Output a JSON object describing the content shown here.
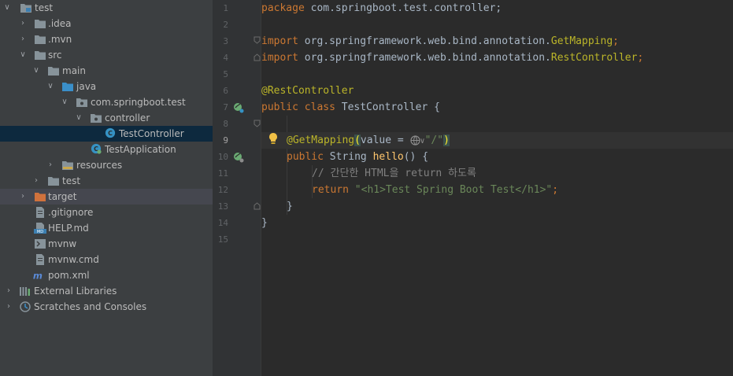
{
  "project_tree": {
    "items": [
      {
        "label": "test",
        "expanded": true,
        "icon": "module-folder-icon"
      },
      {
        "label": ".idea",
        "expanded": false,
        "icon": "folder-icon"
      },
      {
        "label": ".mvn",
        "expanded": false,
        "icon": "folder-icon"
      },
      {
        "label": "src",
        "expanded": true,
        "icon": "folder-icon"
      },
      {
        "label": "main",
        "expanded": true,
        "icon": "folder-icon"
      },
      {
        "label": "java",
        "expanded": true,
        "icon": "source-folder-icon"
      },
      {
        "label": "com.springboot.test",
        "expanded": true,
        "icon": "package-icon"
      },
      {
        "label": "controller",
        "expanded": true,
        "icon": "package-icon"
      },
      {
        "label": "TestController",
        "icon": "class-icon"
      },
      {
        "label": "TestApplication",
        "icon": "spring-boot-class-icon"
      },
      {
        "label": "resources",
        "expanded": false,
        "icon": "resources-folder-icon"
      },
      {
        "label": "test",
        "expanded": false,
        "icon": "folder-icon"
      },
      {
        "label": "target",
        "expanded": false,
        "icon": "excluded-folder-icon"
      },
      {
        "label": ".gitignore",
        "icon": "text-file-icon"
      },
      {
        "label": "HELP.md",
        "icon": "markdown-file-icon"
      },
      {
        "label": "mvnw",
        "icon": "shell-file-icon"
      },
      {
        "label": "mvnw.cmd",
        "icon": "text-file-icon"
      },
      {
        "label": "pom.xml",
        "icon": "maven-file-icon"
      },
      {
        "label": "External Libraries",
        "expanded": false,
        "icon": "libraries-icon"
      },
      {
        "label": "Scratches and Consoles",
        "expanded": false,
        "icon": "scratches-icon"
      }
    ]
  },
  "editor": {
    "line_numbers": [
      "1",
      "2",
      "3",
      "4",
      "5",
      "6",
      "7",
      "8",
      "9",
      "10",
      "11",
      "12",
      "13",
      "14",
      "15"
    ],
    "current_line": "9",
    "code": {
      "l1_kw": "package",
      "l1_rest": " com.springboot.test.controller;",
      "l3_kw": "import",
      "l3_pkg": " org.springframework.web.bind.annotation.",
      "l3_cls": "GetMapping",
      "l3_end": ";",
      "l4_kw": "import",
      "l4_pkg": " org.springframework.web.bind.annotation.",
      "l4_cls": "RestController",
      "l4_end": ";",
      "l6_ann": "@RestController",
      "l7_kw": "public class",
      "l7_rest": " TestController {",
      "l9_ann": "@GetMapping",
      "l9_open": "(",
      "l9_param": "value = ",
      "l9_chev": "∨",
      "l9_str": "\"/\"",
      "l9_close": ")",
      "l10_kw": "public",
      "l10_type": " String ",
      "l10_fn": "hello",
      "l10_rest": "() {",
      "l11_cmt": "// 간단한 HTML을 return 하도록",
      "l12_kw": "return",
      "l12_str": " \"<h1>Test Spring Boot Test</h1>\"",
      "l12_end": ";",
      "l13": "}",
      "l14": "}"
    }
  },
  "colors": {
    "keyword": "#cc7832",
    "annotation": "#bbb529",
    "string": "#6a8759",
    "comment": "#808080",
    "method": "#ffc66d",
    "selection": "#0d293e"
  }
}
